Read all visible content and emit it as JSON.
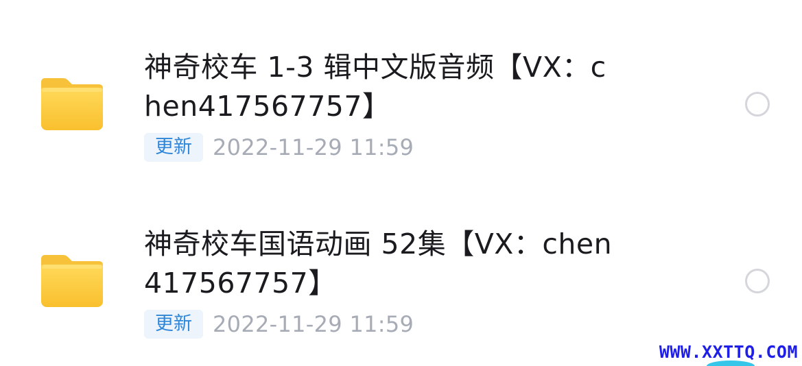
{
  "file_list": {
    "items": [
      {
        "icon": "folder-icon",
        "title": "神奇校车 1-3 辑中文版音频【VX：chen417567757】",
        "badge": "更新",
        "timestamp": "2022-11-29 11:59",
        "selected": false
      },
      {
        "icon": "folder-icon",
        "title": "神奇校车国语动画 52集【VX：chen417567757】",
        "badge": "更新",
        "timestamp": "2022-11-29 11:59",
        "selected": false
      }
    ]
  },
  "watermark": {
    "text": "WWW.XXTTQ.COM"
  },
  "colors": {
    "folder_top": "#fde27a",
    "folder_body": "#fbc93a",
    "badge_text": "#2f86d8",
    "badge_bg": "#eef4fb",
    "timestamp": "#a7abb5",
    "watermark": "#1f1fe8"
  }
}
